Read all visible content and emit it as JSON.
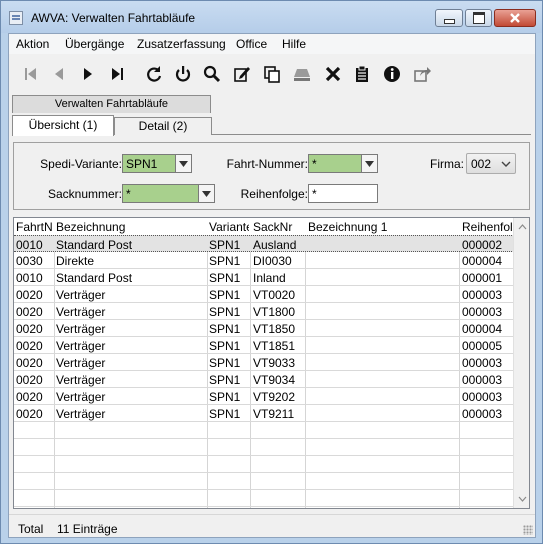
{
  "window": {
    "title": "AWVA: Verwalten Fahrtabläufe"
  },
  "menu": [
    "Aktion",
    "Übergänge",
    "Zusatzerfassung",
    "Office",
    "Hilfe"
  ],
  "toolbar": [
    "first-record-icon",
    "previous-record-icon",
    "next-record-icon",
    "last-record-icon",
    "refresh-icon",
    "power-icon",
    "search-icon",
    "edit-icon",
    "copy-icon",
    "eraser-icon",
    "delete-icon",
    "clipboard-icon",
    "info-icon",
    "export-icon"
  ],
  "outer_tab": "Verwalten Fahrtabläufe",
  "tabs": {
    "active": "Übersicht (1)",
    "inactive": "Detail (2)"
  },
  "filters": {
    "spedi_label": "Spedi-Variante:",
    "spedi_value": "SPN1",
    "fahrt_label": "Fahrt-Nummer:",
    "fahrt_value": "*",
    "firma_label": "Firma:",
    "firma_value": "002",
    "sack_label": "Sacknummer:",
    "sack_value": "*",
    "reihen_label": "Reihenfolge:",
    "reihen_value": "*"
  },
  "colors": {
    "required_field": "#a8d08d",
    "selected_row": "#e3e3e3"
  },
  "table": {
    "headers": [
      "FahrtNr",
      "Bezeichnung",
      "Variante",
      "SackNr",
      "Bezeichnung 1",
      "Reihenfolg"
    ],
    "rows": [
      [
        "0010",
        "Standard Post",
        "SPN1",
        "Ausland",
        "",
        "000002"
      ],
      [
        "0030",
        "Direkte",
        "SPN1",
        "DI0030",
        "",
        "000004"
      ],
      [
        "0010",
        "Standard Post",
        "SPN1",
        "Inland",
        "",
        "000001"
      ],
      [
        "0020",
        "Verträger",
        "SPN1",
        "VT0020",
        "",
        "000003"
      ],
      [
        "0020",
        "Verträger",
        "SPN1",
        "VT1800",
        "",
        "000003"
      ],
      [
        "0020",
        "Verträger",
        "SPN1",
        "VT1850",
        "",
        "000004"
      ],
      [
        "0020",
        "Verträger",
        "SPN1",
        "VT1851",
        "",
        "000005"
      ],
      [
        "0020",
        "Verträger",
        "SPN1",
        "VT9033",
        "",
        "000003"
      ],
      [
        "0020",
        "Verträger",
        "SPN1",
        "VT9034",
        "",
        "000003"
      ],
      [
        "0020",
        "Verträger",
        "SPN1",
        "VT9202",
        "",
        "000003"
      ],
      [
        "0020",
        "Verträger",
        "SPN1",
        "VT9211",
        "",
        "000003"
      ]
    ],
    "selected_index": 0
  },
  "status": {
    "label": "Total",
    "count": "11 Einträge"
  }
}
